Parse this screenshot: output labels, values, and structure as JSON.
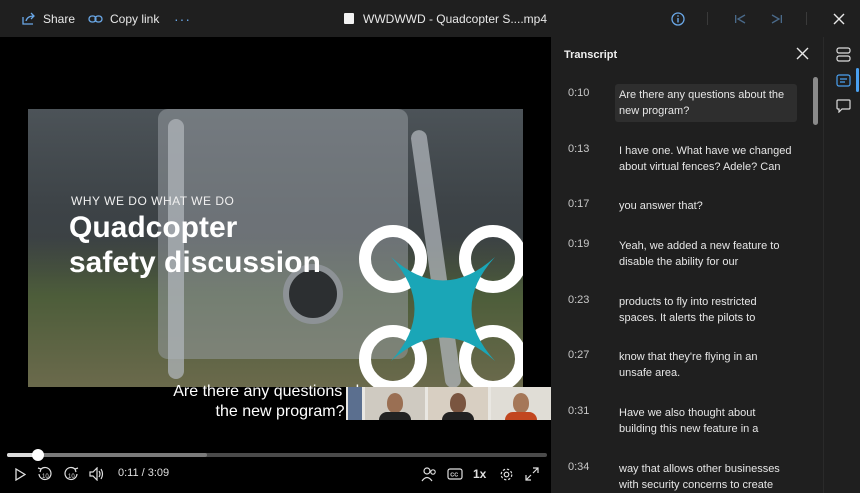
{
  "toolbar": {
    "share_label": "Share",
    "copy_link_label": "Copy link",
    "more_icon": "more-horizontal-icon",
    "file_title": "WWDWWD - Quadcopter S....mp4"
  },
  "video": {
    "kicker": "WHY WE DO WHAT WE DO",
    "title_line1": "Quadcopter",
    "title_line2": "safety discussion",
    "caption_line1": "Are there any questions about",
    "caption_line2": "the new program?",
    "progress_fraction": 0.058,
    "buffered_fraction": 0.37,
    "brand_color": "#1aa6b7"
  },
  "controls": {
    "time": "0:11 / 3:09",
    "speed": "1x",
    "skip_back_label": "10",
    "skip_fwd_label": "10",
    "cc_label": "CC"
  },
  "transcript": {
    "title": "Transcript",
    "entries": [
      {
        "time": "0:10",
        "line1": "Are there any questions about the",
        "line2": "new program?"
      },
      {
        "time": "0:13",
        "line1": "I have one. What have we changed",
        "line2": "about virtual fences? Adele? Can"
      },
      {
        "time": "0:17",
        "line1": "you answer that?",
        "line2": ""
      },
      {
        "time": "0:19",
        "line1": "Yeah, we added a new feature to",
        "line2": "disable the ability for our"
      },
      {
        "time": "0:23",
        "line1": "products to fly into restricted",
        "line2": "spaces. It alerts the pilots to"
      },
      {
        "time": "0:27",
        "line1": "know that they're flying in an",
        "line2": "unsafe area."
      },
      {
        "time": "0:31",
        "line1": "Have we also thought about",
        "line2": "building this new feature in a"
      },
      {
        "time": "0:34",
        "line1": "way that allows other businesses",
        "line2": "with security concerns to create"
      }
    ]
  },
  "colors": {
    "accent": "#4aa0f0",
    "panel_bg": "#1f1f1f"
  }
}
